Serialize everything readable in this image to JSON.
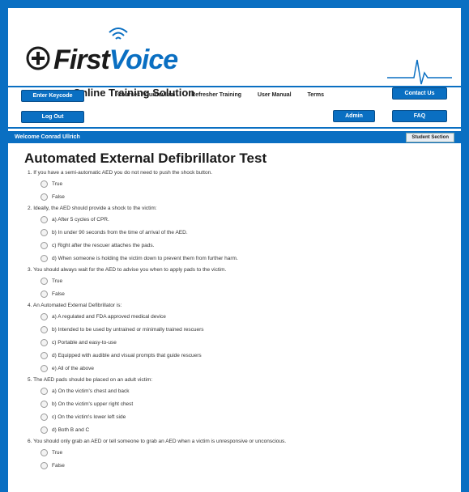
{
  "brand": {
    "name_first": "First",
    "name_voice": "Voice",
    "tagline": "Online Training Solution"
  },
  "buttons": {
    "enter_keycode": "Enter Keycode",
    "log_out": "Log Out",
    "contact_us": "Contact Us",
    "admin": "Admin",
    "faq": "FAQ",
    "student_section": "Student Section"
  },
  "nav": [
    "Courses / Curriculum",
    "Refresher Training",
    "User Manual",
    "Terms"
  ],
  "welcome": "Welcome Conrad Ullrich",
  "test_title": "Automated External Defibrillator Test",
  "questions": [
    {
      "text": "1. If you have a semi-automatic AED you do not need to push the shock button.",
      "options": [
        "True",
        "False"
      ]
    },
    {
      "text": "2. Ideally, the AED should provide a shock to the victim:",
      "options": [
        "a) After 5 cycles of CPR.",
        "b) In under 90 seconds from the time of arrival of the AED.",
        "c) Right after the rescuer attaches the pads.",
        "d) When someone is holding the victim down to prevent them from further harm."
      ]
    },
    {
      "text": "3. You should always wait for the AED to advise you when to apply pads to the victim.",
      "options": [
        "True",
        "False"
      ]
    },
    {
      "text": "4. An Automated External Defibrillator is:",
      "options": [
        "a) A regulated and FDA approved medical device",
        "b) Intended to be used by untrained or minimally trained rescuers",
        "c) Portable and easy-to-use",
        "d) Equipped with audible and visual prompts that guide rescuers",
        "e) All of the above"
      ]
    },
    {
      "text": "5. The AED pads should be placed on an adult victim:",
      "options": [
        "a) On the victim's chest and back",
        "b) On the victim's upper right chest",
        "c) On the victim's lower left side",
        "d) Both B and C"
      ]
    },
    {
      "text": "6. You should only grab an AED or tell someone to grab an AED when a victim is unresponsive or unconscious.",
      "options": [
        "True",
        "False"
      ]
    }
  ],
  "colors": {
    "brand_blue": "#0a6fc2",
    "background": "#ffffff"
  }
}
